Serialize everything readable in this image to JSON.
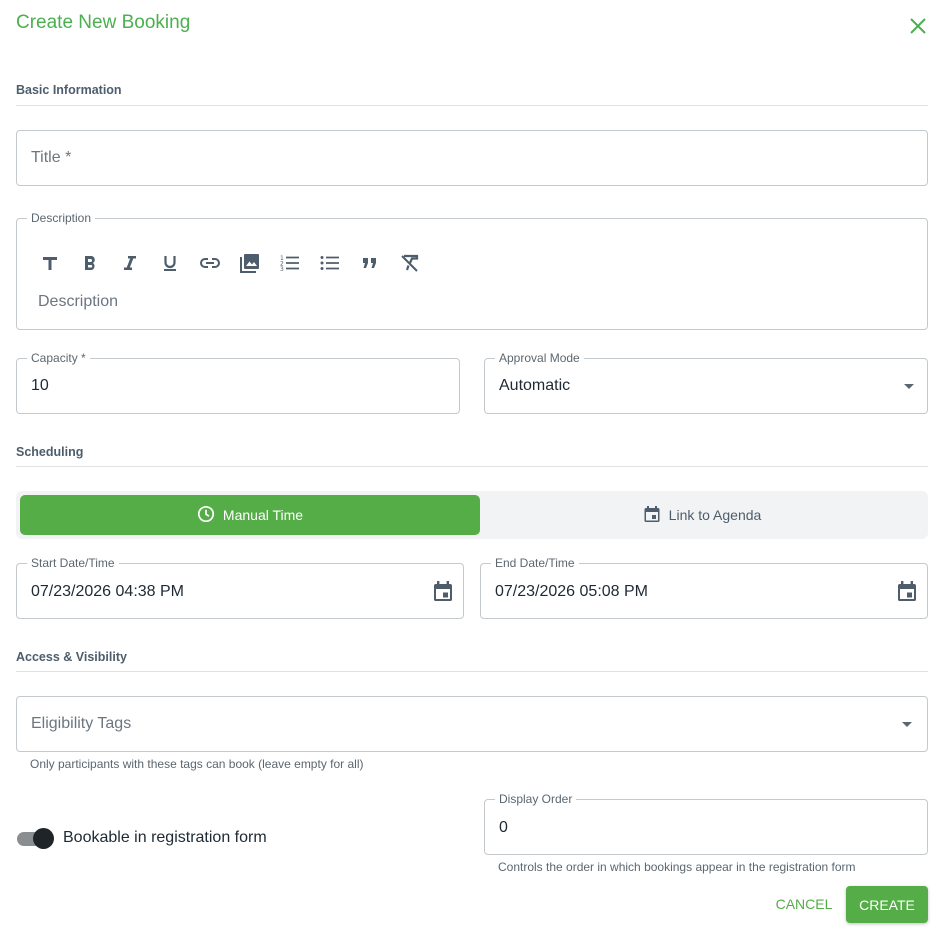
{
  "dialog": {
    "title": "Create New Booking"
  },
  "sections": {
    "basic": "Basic Information",
    "scheduling": "Scheduling",
    "access": "Access & Visibility"
  },
  "fields": {
    "title": {
      "placeholder": "Title *"
    },
    "description": {
      "label": "Description",
      "placeholder": "Description",
      "toolbar": [
        "text-style-icon",
        "bold-icon",
        "italic-icon",
        "underline-icon",
        "link-icon",
        "image-icon",
        "ordered-list-icon",
        "bullet-list-icon",
        "quote-icon",
        "clear-format-icon"
      ]
    },
    "capacity": {
      "label": "Capacity *",
      "value": "10"
    },
    "approval_mode": {
      "label": "Approval Mode",
      "value": "Automatic"
    },
    "start": {
      "label": "Start Date/Time",
      "value": "07/23/2026 04:38 PM"
    },
    "end": {
      "label": "End Date/Time",
      "value": "07/23/2026 05:08 PM"
    },
    "eligibility": {
      "placeholder": "Eligibility Tags",
      "helper": "Only participants with these tags can book (leave empty for all)"
    },
    "display_order": {
      "label": "Display Order",
      "value": "0",
      "helper": "Controls the order in which bookings appear in the registration form"
    }
  },
  "scheduling_toggle": {
    "manual": "Manual Time",
    "agenda": "Link to Agenda",
    "selected": "manual"
  },
  "bookable": {
    "label": "Bookable in registration form",
    "checked": true
  },
  "actions": {
    "cancel": "CANCEL",
    "create": "CREATE"
  },
  "colors": {
    "accent": "#55ad48",
    "title": "#4caf50",
    "text": "#1f2933",
    "muted": "#5b6770"
  }
}
